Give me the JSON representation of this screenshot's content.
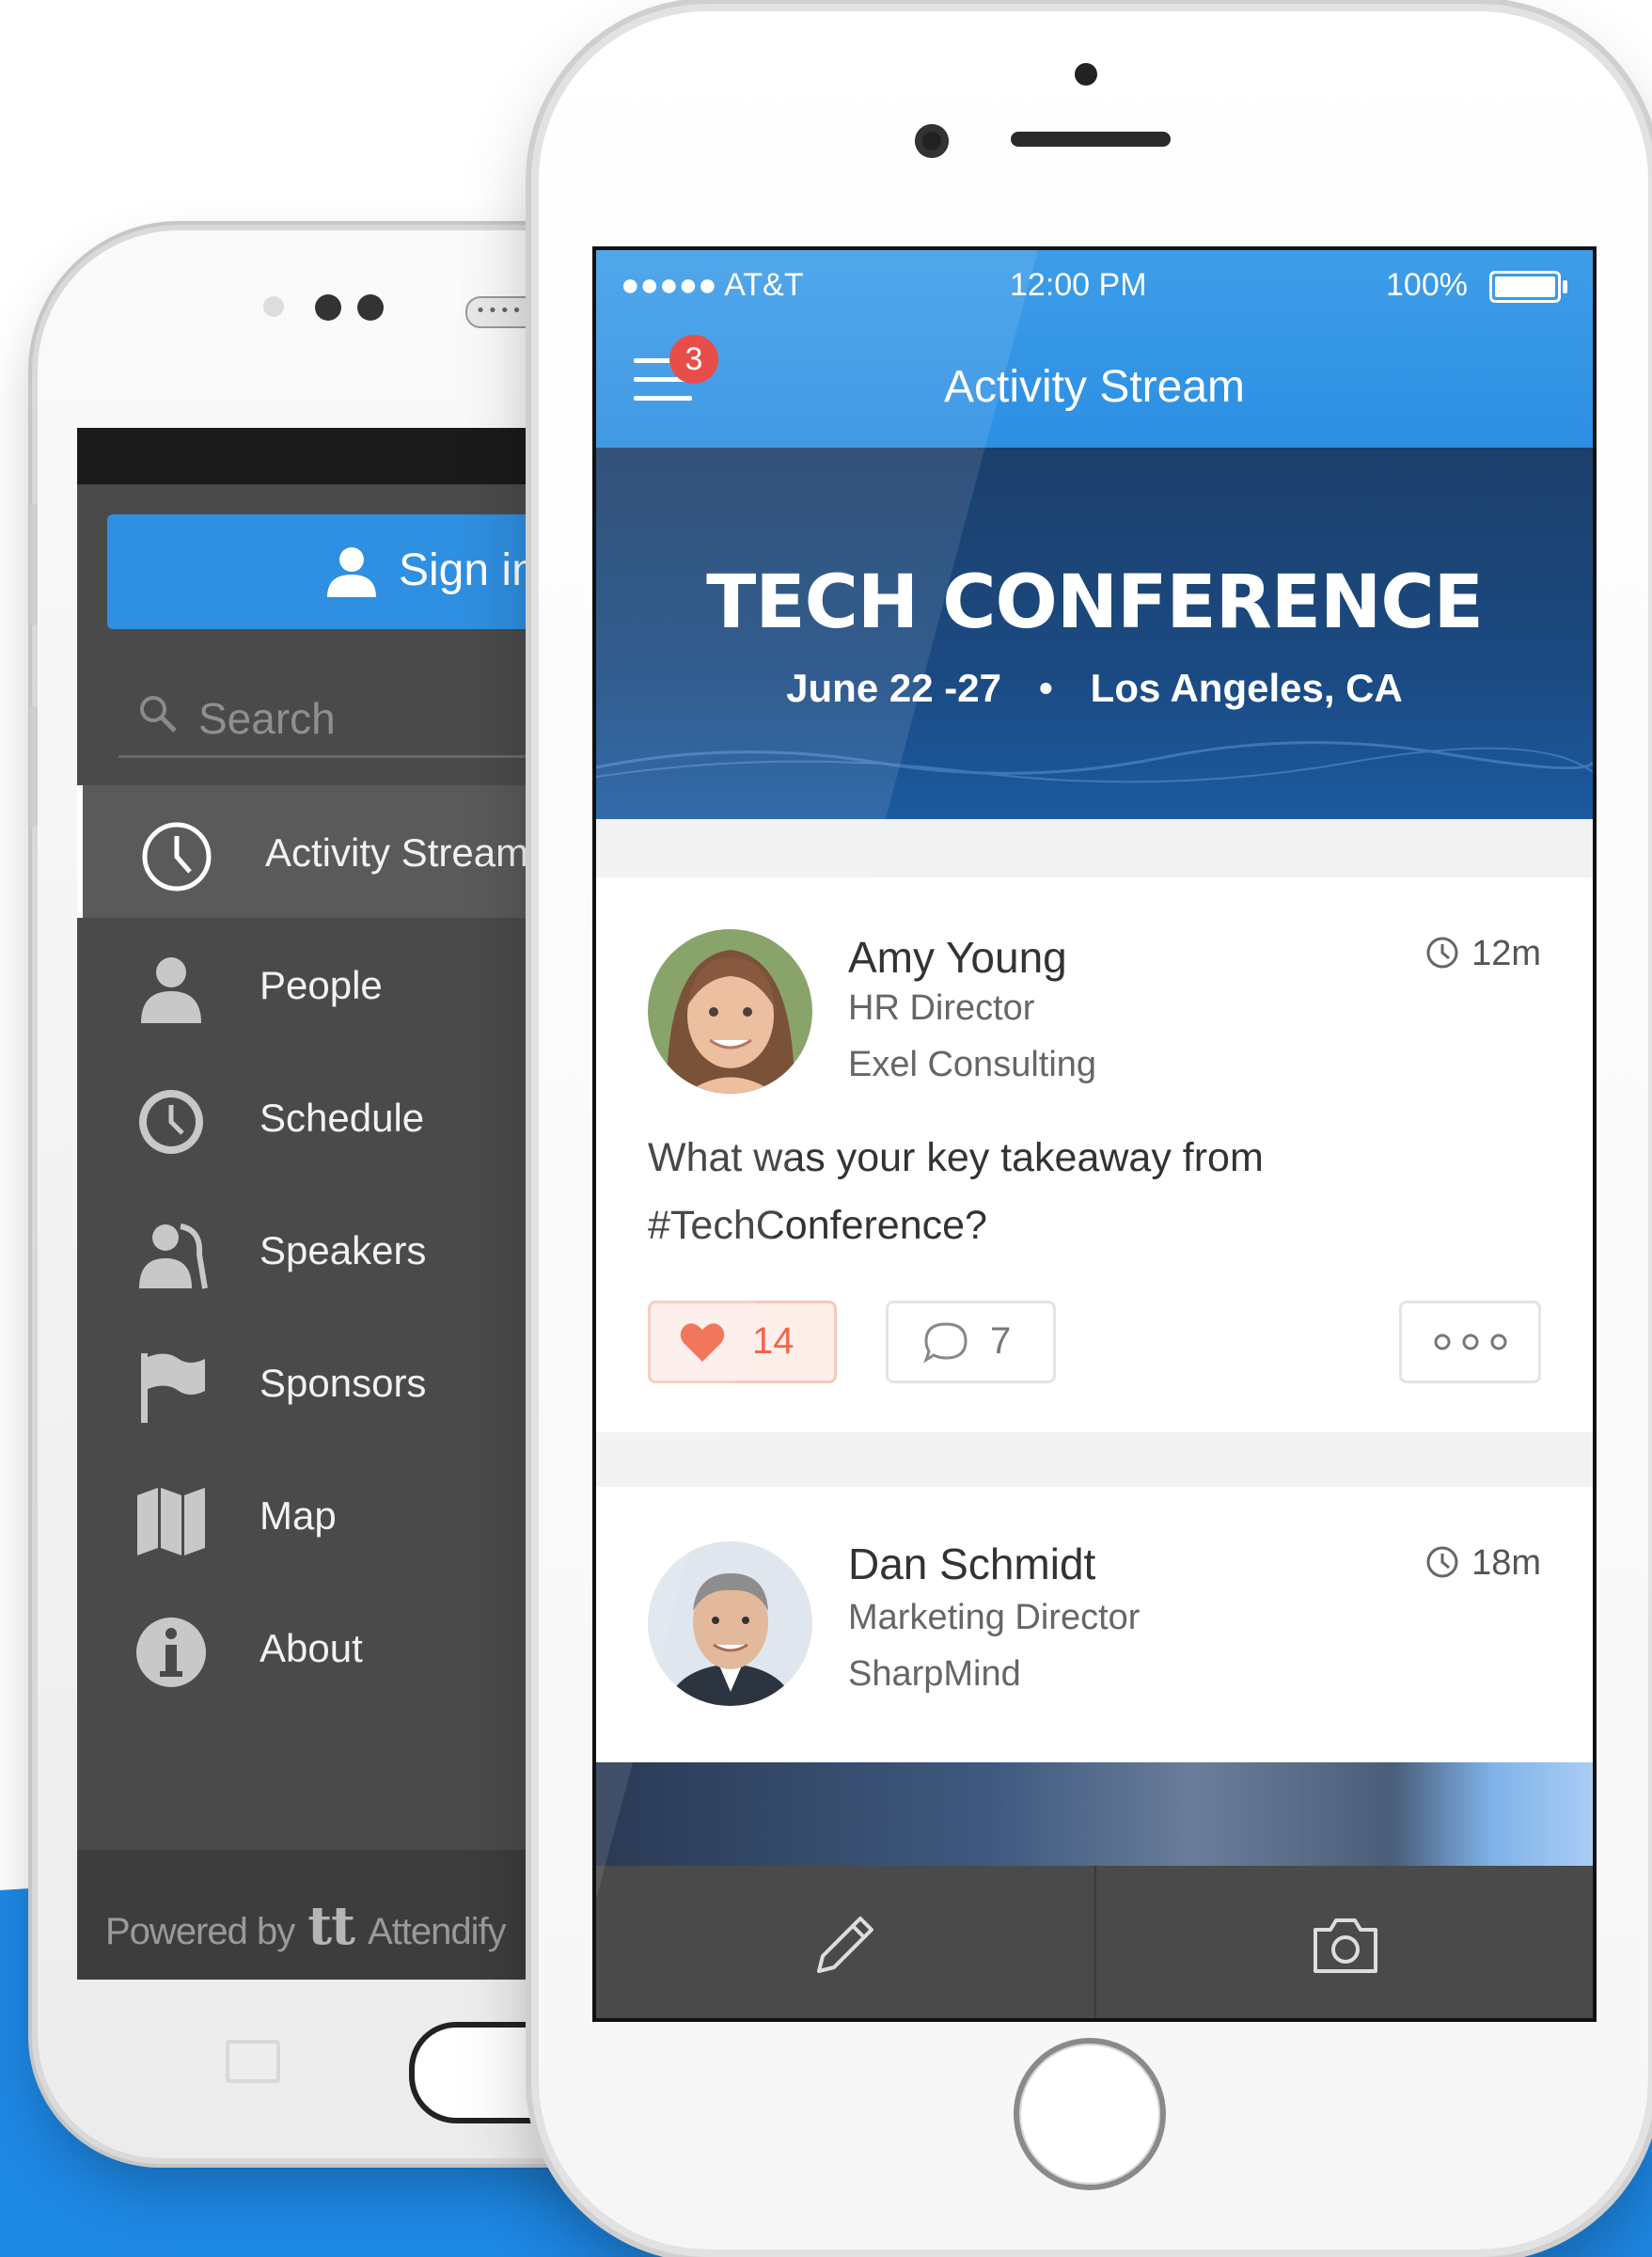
{
  "android": {
    "signin_label": "Sign in",
    "search_placeholder": "Search",
    "menu": [
      {
        "label": "Activity Stream",
        "icon": "clock-icon",
        "active": true
      },
      {
        "label": "People",
        "icon": "person-icon"
      },
      {
        "label": "Schedule",
        "icon": "clock-icon"
      },
      {
        "label": "Speakers",
        "icon": "speakers-icon"
      },
      {
        "label": "Sponsors",
        "icon": "flag-icon"
      },
      {
        "label": "Map",
        "icon": "map-icon"
      },
      {
        "label": "About",
        "icon": "info-icon"
      }
    ],
    "footer": {
      "powered": "Powered by",
      "logo": "tt",
      "brand": "Attendify"
    }
  },
  "iphone": {
    "status": {
      "carrier": "●●●●● AT&T",
      "time": "12:00 PM",
      "battery": "100%"
    },
    "header": {
      "title": "Activity Stream",
      "badge": "3"
    },
    "banner": {
      "title": "TECH CONFERENCE",
      "dates": "June 22 -27",
      "separator": "•",
      "location": "Los Angeles, CA"
    },
    "posts": [
      {
        "name": "Amy Young",
        "role": "HR Director",
        "company": "Exel Consulting",
        "time": "12m",
        "text_line1": "What was your key takeaway from",
        "text_line2": "#TechConference?",
        "likes": "14",
        "comments": "7"
      },
      {
        "name": "Dan Schmidt",
        "role": "Marketing Director",
        "company": "SharpMind",
        "time": "18m"
      }
    ]
  },
  "colors": {
    "accent": "#2d8fe3",
    "like": "#f0664a",
    "badge": "#e53935",
    "sidebar": "#4a4a4a"
  }
}
